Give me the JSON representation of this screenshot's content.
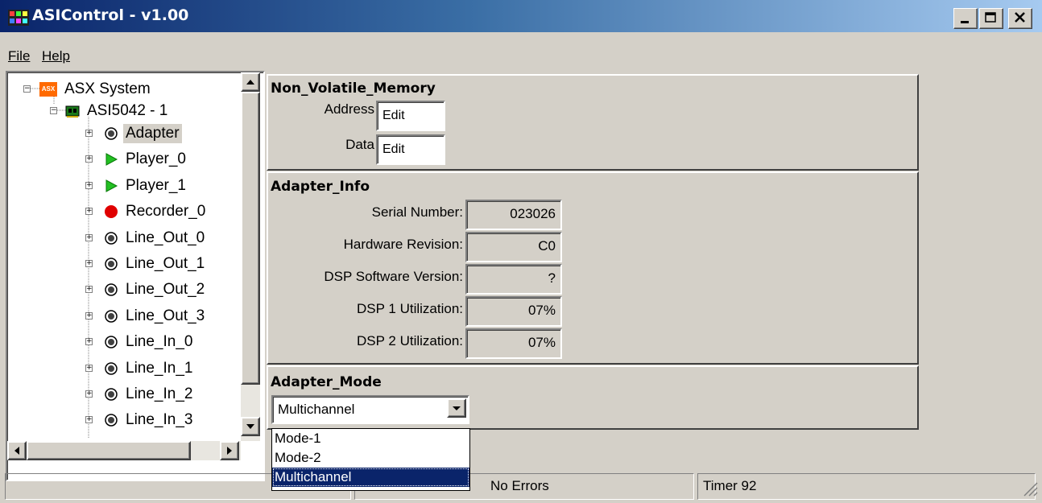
{
  "window": {
    "title": "ASIControl - v1.00",
    "controls": [
      "minimize",
      "maximize",
      "close"
    ]
  },
  "menu": {
    "file": "File",
    "help": "Help"
  },
  "tree": {
    "root": "ASX System",
    "root_icon_text": "ASX",
    "adapter": "ASI5042 - 1",
    "nodes": [
      {
        "label": "Adapter",
        "icon": "gear-icon",
        "selected": true
      },
      {
        "label": "Player_0",
        "icon": "play-icon"
      },
      {
        "label": "Player_1",
        "icon": "play-icon"
      },
      {
        "label": "Recorder_0",
        "icon": "record-icon"
      },
      {
        "label": "Line_Out_0",
        "icon": "gear-icon"
      },
      {
        "label": "Line_Out_1",
        "icon": "gear-icon"
      },
      {
        "label": "Line_Out_2",
        "icon": "gear-icon"
      },
      {
        "label": "Line_Out_3",
        "icon": "gear-icon"
      },
      {
        "label": "Line_In_0",
        "icon": "gear-icon"
      },
      {
        "label": "Line_In_1",
        "icon": "gear-icon"
      },
      {
        "label": "Line_In_2",
        "icon": "gear-icon"
      },
      {
        "label": "Line_In_3",
        "icon": "gear-icon"
      }
    ]
  },
  "nvm": {
    "title": "Non_Volatile_Memory",
    "address_label": "Address",
    "address_value": "Edit",
    "data_label": "Data",
    "data_value": "Edit"
  },
  "adapter_info": {
    "title": "Adapter_Info",
    "fields": [
      {
        "label": "Serial Number:",
        "value": "023026"
      },
      {
        "label": "Hardware Revision:",
        "value": "C0"
      },
      {
        "label": "DSP Software Version:",
        "value": "?"
      },
      {
        "label": "DSP 1 Utilization:",
        "value": "07%"
      },
      {
        "label": "DSP 2 Utilization:",
        "value": "07%"
      }
    ]
  },
  "adapter_mode": {
    "title": "Adapter_Mode",
    "selected": "Multichannel",
    "options": [
      "Mode-1",
      "Mode-2",
      "Multichannel"
    ],
    "highlighted_option": "Multichannel"
  },
  "status": {
    "message": "No Errors",
    "timer": "Timer 92"
  },
  "colors": {
    "title_gradient_start": "#0a246a",
    "title_gradient_end": "#a6caf0",
    "selection": "#0a246a",
    "chrome": "#d4d0c8",
    "play": "#22c022",
    "record": "#e00000"
  }
}
